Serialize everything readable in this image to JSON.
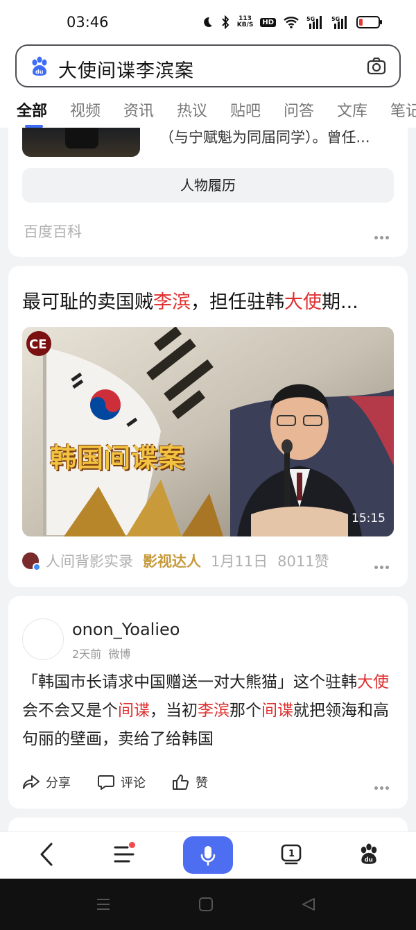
{
  "status_bar": {
    "time": "03:46",
    "net_speed_value": "113",
    "net_speed_unit": "KB/S",
    "hd_badge": "HD",
    "signal1": "5G",
    "signal2": "5G"
  },
  "search": {
    "query": "大使间谍李滨案"
  },
  "tabs": [
    "全部",
    "视频",
    "资讯",
    "热议",
    "贴吧",
    "问答",
    "文库",
    "笔记"
  ],
  "card1": {
    "cut_text": "（与宁赋魁为同届同学）。曾任...",
    "button_label": "人物履历",
    "source": "百度百科"
  },
  "card2": {
    "title_parts": [
      {
        "text": "最可耻的卖国贼",
        "highlight": false
      },
      {
        "text": "李滨",
        "highlight": true
      },
      {
        "text": "，担任驻韩",
        "highlight": false
      },
      {
        "text": "大使",
        "highlight": true
      },
      {
        "text": "期...",
        "highlight": false
      }
    ],
    "video_overlay_text": "韩国间谍案",
    "video_badge": "CE",
    "duration": "15:15",
    "author": "人间背影实录",
    "author_tag": "影视达人",
    "date": "1月11日",
    "likes": "8011赞"
  },
  "card3": {
    "username": "onon_Yoalieo",
    "time": "2天前",
    "platform": "微博",
    "post_parts": [
      {
        "text": "「韩国市长请求中国赠送一对大熊猫」这个驻韩",
        "highlight": false
      },
      {
        "text": "大使",
        "highlight": true
      },
      {
        "text": "会不会又是个",
        "highlight": false
      },
      {
        "text": "间谍",
        "highlight": true
      },
      {
        "text": "，当初",
        "highlight": false
      },
      {
        "text": "李滨",
        "highlight": true
      },
      {
        "text": "那个",
        "highlight": false
      },
      {
        "text": "间谍",
        "highlight": true
      },
      {
        "text": "就把领海和高句丽的壁画，卖给了给韩国",
        "highlight": false
      }
    ],
    "share": "分享",
    "comment": "评论",
    "like": "赞"
  },
  "bottom_nav": {
    "tab_count_badge": "1"
  },
  "colors": {
    "highlight": "#e02f2f",
    "accent": "#4e6ef2",
    "tag": "#c69a3b"
  }
}
